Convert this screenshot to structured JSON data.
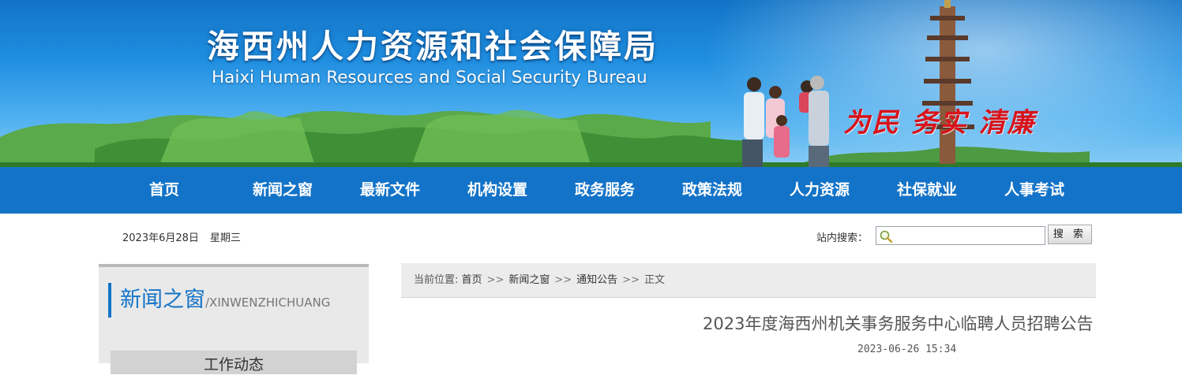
{
  "banner": {
    "title": "海西州人力资源和社会保障局",
    "subtitle": "Haixi Human Resources and Social Security Bureau",
    "slogan": "为民 务实 清廉"
  },
  "nav": {
    "items": [
      "首页",
      "新闻之窗",
      "最新文件",
      "机构设置",
      "政务服务",
      "政策法规",
      "人力资源",
      "社保就业",
      "人事考试"
    ]
  },
  "topbar": {
    "date": "2023年6月28日",
    "weekday": "星期三",
    "search_label": "站内搜索：",
    "search_value": "",
    "search_button": "搜 索"
  },
  "sidebar": {
    "title_cn": "新闻之窗",
    "title_en": "/XINWENZHICHUANG",
    "item": "工作动态"
  },
  "breadcrumb": {
    "prefix": "当前位置:",
    "items": [
      "首页",
      "新闻之窗",
      "通知公告"
    ],
    "current": "正文",
    "separator": ">>"
  },
  "article": {
    "title": "2023年度海西州机关事务服务中心临聘人员招聘公告",
    "datetime": "2023-06-26 15:34"
  },
  "colors": {
    "primary_blue": "#1373c8",
    "slogan_red": "#d8131b"
  }
}
